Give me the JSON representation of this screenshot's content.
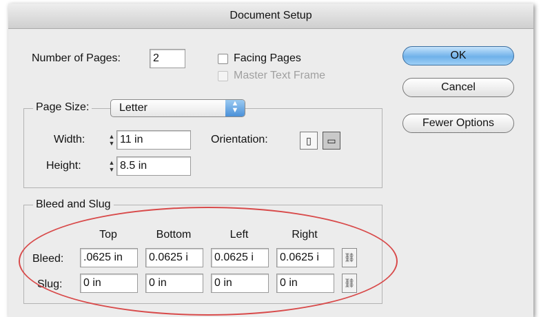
{
  "window": {
    "title": "Document Setup"
  },
  "pages": {
    "label": "Number of Pages:",
    "value": "2"
  },
  "facing_pages": {
    "label": "Facing Pages",
    "checked": false
  },
  "master_text_frame": {
    "label": "Master Text Frame",
    "checked": false,
    "enabled": false
  },
  "buttons": {
    "ok": "OK",
    "cancel": "Cancel",
    "fewer_options": "Fewer Options"
  },
  "page_size": {
    "label": "Page Size:",
    "selected": "Letter",
    "width_label": "Width:",
    "width_value": "11 in",
    "height_label": "Height:",
    "height_value": "8.5 in",
    "orientation_label": "Orientation:",
    "orientation_selected": "landscape"
  },
  "bleed_slug": {
    "title": "Bleed and Slug",
    "columns": [
      "Top",
      "Bottom",
      "Left",
      "Right"
    ],
    "bleed_label": "Bleed:",
    "bleed_values": [
      ".0625 in",
      "0.0625 i",
      "0.0625 i",
      "0.0625 i"
    ],
    "slug_label": "Slug:",
    "slug_values": [
      "0 in",
      "0 in",
      "0 in",
      "0 in"
    ]
  },
  "annotation": {
    "color": "#d84a4a"
  }
}
